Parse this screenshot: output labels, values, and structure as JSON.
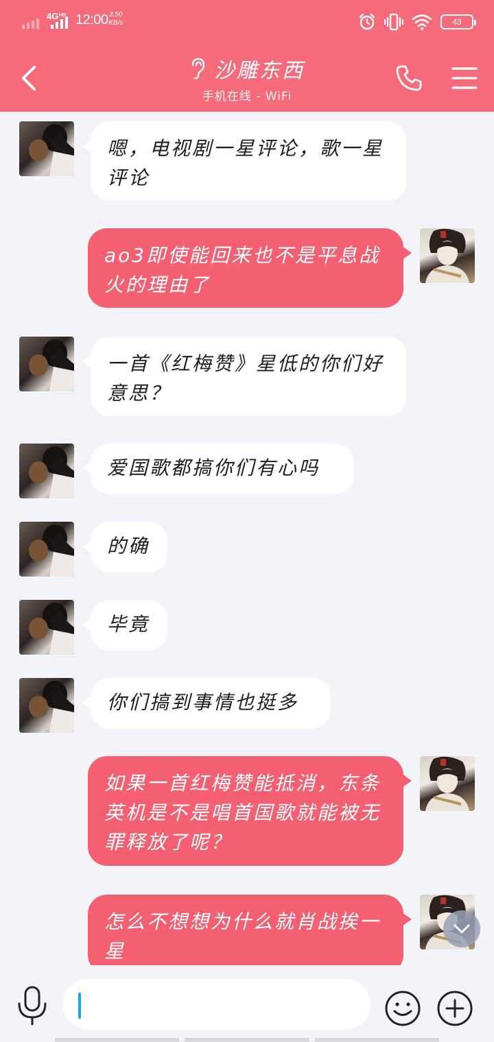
{
  "status_bar": {
    "network": "4G",
    "network_badge": "HD",
    "time": "12:00",
    "speed_value": "3.50",
    "speed_unit": "KB/s",
    "battery": "43"
  },
  "header": {
    "title": "沙雕东西",
    "subtitle": "手机在线 - WiFi",
    "icons": [
      "back-icon",
      "ear-icon",
      "phone-icon",
      "menu-icon"
    ]
  },
  "messages": [
    {
      "from": "friend",
      "text": "嗯，电视剧一星评论，歌一星评论"
    },
    {
      "from": "me",
      "text": "ao3即使能回来也不是平息战火的理由了"
    },
    {
      "from": "friend",
      "text": "一首《红梅赞》星低的你们好意思？"
    },
    {
      "from": "friend",
      "text": "爱国歌都搞你们有心吗"
    },
    {
      "from": "friend",
      "text": "的确"
    },
    {
      "from": "friend",
      "text": "毕竟"
    },
    {
      "from": "friend",
      "text": "你们搞到事情也挺多"
    },
    {
      "from": "me",
      "text": "如果一首红梅赞能抵消，东条英机是不是唱首国歌就能被无罪释放了呢？"
    },
    {
      "from": "me",
      "text": "怎么不想想为什么就肖战挨一星"
    }
  ],
  "input_bar": {
    "value": "",
    "icons": [
      "microphone-icon",
      "emoji-icon",
      "plus-icon"
    ]
  },
  "colors": {
    "accent": "#f56b7b",
    "outgoing_bubble": "#f45f72",
    "incoming_bubble": "#ffffff",
    "background": "#f3f4f9",
    "caret": "#1aa7e8"
  }
}
